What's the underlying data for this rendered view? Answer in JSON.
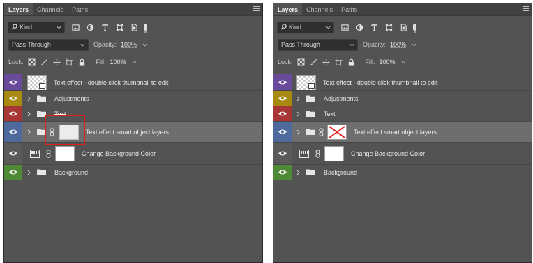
{
  "colors": {
    "panel_bg": "#535353",
    "tab_bar": "#424242",
    "selected_row": "#6e6e6e",
    "highlight_box": "#e02020",
    "tag_violet": "#6a4a9a",
    "tag_yellow": "#a88a10",
    "tag_red": "#a83636",
    "tag_blue": "#4e6a9c",
    "tag_none": "#5a5a5a",
    "tag_green": "#4f8a37"
  },
  "panels": [
    {
      "tabs": [
        "Layers",
        "Channels",
        "Paths"
      ],
      "filter": {
        "kind_label": "Kind",
        "icons": [
          "image-filter-icon",
          "adjustment-filter-icon",
          "type-filter-icon",
          "shape-filter-icon",
          "smart-object-filter-icon"
        ]
      },
      "blend_mode": "Pass Through",
      "opacity_label": "Opacity:",
      "opacity_value": "100%",
      "lock_label": "Lock:",
      "lock_icons": [
        "lock-transparent-icon",
        "lock-pixels-icon",
        "lock-position-icon",
        "lock-artboard-icon",
        "lock-all-icon"
      ],
      "fill_label": "Fill:",
      "fill_value": "100%",
      "layers": [
        {
          "name": "Text effect - double click thumbnail to edit",
          "tag": "violet",
          "type": "smart-object"
        },
        {
          "name": "Adjustments",
          "tag": "yellow",
          "type": "group"
        },
        {
          "name": "Text",
          "tag": "red",
          "type": "group"
        },
        {
          "name": "Text effect smart object layers",
          "tag": "blue",
          "type": "group-linked",
          "selected": true
        },
        {
          "name": "Change Background Color",
          "tag": "none",
          "type": "adjustment"
        },
        {
          "name": "Background",
          "tag": "green",
          "type": "group"
        }
      ]
    },
    {
      "tabs": [
        "Layers",
        "Channels",
        "Paths"
      ],
      "filter": {
        "kind_label": "Kind",
        "icons": [
          "image-filter-icon",
          "adjustment-filter-icon",
          "type-filter-icon",
          "shape-filter-icon",
          "smart-object-filter-icon"
        ]
      },
      "blend_mode": "Pass Through",
      "opacity_label": "Opacity:",
      "opacity_value": "100%",
      "lock_label": "Lock:",
      "lock_icons": [
        "lock-transparent-icon",
        "lock-pixels-icon",
        "lock-position-icon",
        "lock-artboard-icon",
        "lock-all-icon"
      ],
      "fill_label": "Fill:",
      "fill_value": "100%",
      "layers": [
        {
          "name": "Text effect - double click thumbnail to edit",
          "tag": "violet",
          "type": "smart-object"
        },
        {
          "name": "Adjustments",
          "tag": "yellow",
          "type": "group"
        },
        {
          "name": "Text",
          "tag": "red",
          "type": "group"
        },
        {
          "name": "Text effect smart object layers",
          "tag": "blue",
          "type": "group-linked",
          "selected": true
        },
        {
          "name": "Change Background Color",
          "tag": "none",
          "type": "adjustment"
        },
        {
          "name": "Background",
          "tag": "green",
          "type": "group"
        }
      ]
    }
  ]
}
